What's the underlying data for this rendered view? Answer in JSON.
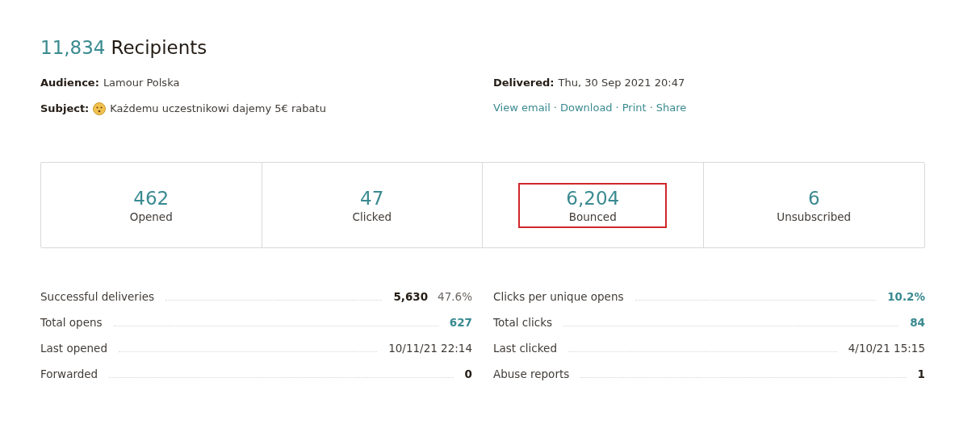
{
  "header": {
    "count": "11,834",
    "title": "Recipients"
  },
  "details_left": [
    {
      "label": "Audience:",
      "value": "Lamour Polska",
      "emoji": false
    },
    {
      "label": "Subject:",
      "value": "Każdemu uczestnikowi dajemy 5€ rabatu",
      "emoji": true
    }
  ],
  "details_right": {
    "label": "Delivered:",
    "value": "Thu, 30 Sep 2021 20:47",
    "links": [
      "View email",
      "Download",
      "Print",
      "Share"
    ],
    "separator": "·"
  },
  "stats": [
    {
      "value": "462",
      "label": "Opened",
      "highlighted": false
    },
    {
      "value": "47",
      "label": "Clicked",
      "highlighted": false
    },
    {
      "value": "6,204",
      "label": "Bounced",
      "highlighted": true
    },
    {
      "value": "6",
      "label": "Unsubscribed",
      "highlighted": false
    }
  ],
  "metrics_left": [
    {
      "label": "Successful deliveries",
      "value": "5,630",
      "kind": "bold",
      "percent": "47.6%"
    },
    {
      "label": "Total opens",
      "value": "627",
      "kind": "link"
    },
    {
      "label": "Last opened",
      "value": "10/11/21 22:14",
      "kind": "plain"
    },
    {
      "label": "Forwarded",
      "value": "0",
      "kind": "bold"
    }
  ],
  "metrics_right": [
    {
      "label": "Clicks per unique opens",
      "value": "10.2%",
      "kind": "link"
    },
    {
      "label": "Total clicks",
      "value": "84",
      "kind": "link"
    },
    {
      "label": "Last clicked",
      "value": "4/10/21 15:15",
      "kind": "plain"
    },
    {
      "label": "Abuse reports",
      "value": "1",
      "kind": "bold"
    }
  ]
}
